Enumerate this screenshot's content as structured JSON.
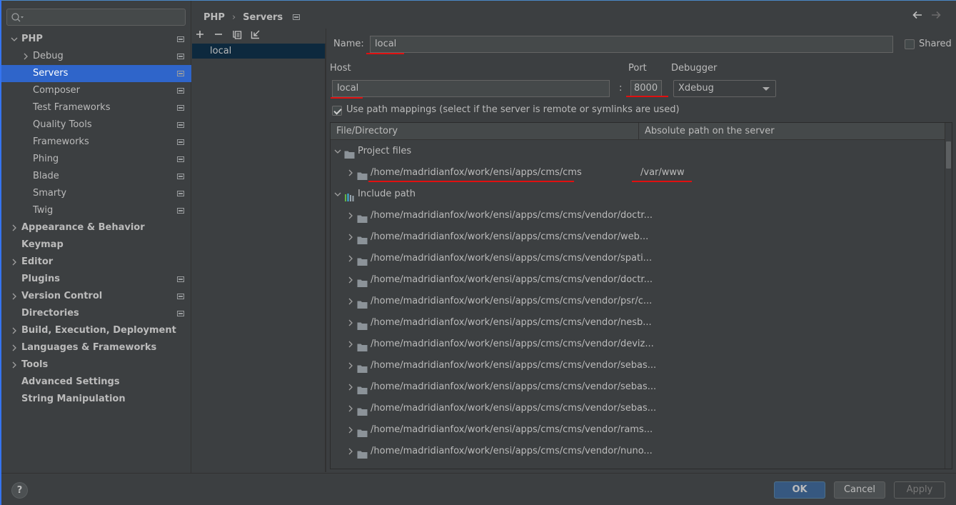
{
  "sidebar": {
    "search": {
      "placeholder": "",
      "value": ""
    },
    "items": [
      {
        "label": "PHP",
        "bold": true,
        "indent": 0,
        "chevron": "expanded",
        "project_icon": true
      },
      {
        "label": "Debug",
        "bold": false,
        "indent": 1,
        "chevron": "collapsed",
        "project_icon": true
      },
      {
        "label": "Servers",
        "bold": false,
        "indent": 1,
        "chevron": "none",
        "project_icon": true,
        "selected": true
      },
      {
        "label": "Composer",
        "bold": false,
        "indent": 1,
        "chevron": "none",
        "project_icon": true
      },
      {
        "label": "Test Frameworks",
        "bold": false,
        "indent": 1,
        "chevron": "none",
        "project_icon": true
      },
      {
        "label": "Quality Tools",
        "bold": false,
        "indent": 1,
        "chevron": "none",
        "project_icon": true
      },
      {
        "label": "Frameworks",
        "bold": false,
        "indent": 1,
        "chevron": "none",
        "project_icon": true
      },
      {
        "label": "Phing",
        "bold": false,
        "indent": 1,
        "chevron": "none",
        "project_icon": true
      },
      {
        "label": "Blade",
        "bold": false,
        "indent": 1,
        "chevron": "none",
        "project_icon": true
      },
      {
        "label": "Smarty",
        "bold": false,
        "indent": 1,
        "chevron": "none",
        "project_icon": true
      },
      {
        "label": "Twig",
        "bold": false,
        "indent": 1,
        "chevron": "none",
        "project_icon": true
      },
      {
        "label": "Appearance & Behavior",
        "bold": true,
        "indent": 0,
        "chevron": "collapsed",
        "project_icon": false
      },
      {
        "label": "Keymap",
        "bold": true,
        "indent": 0,
        "chevron": "none",
        "project_icon": false
      },
      {
        "label": "Editor",
        "bold": true,
        "indent": 0,
        "chevron": "collapsed",
        "project_icon": false
      },
      {
        "label": "Plugins",
        "bold": true,
        "indent": 0,
        "chevron": "none",
        "project_icon": true
      },
      {
        "label": "Version Control",
        "bold": true,
        "indent": 0,
        "chevron": "collapsed",
        "project_icon": true
      },
      {
        "label": "Directories",
        "bold": true,
        "indent": 0,
        "chevron": "none",
        "project_icon": true
      },
      {
        "label": "Build, Execution, Deployment",
        "bold": true,
        "indent": 0,
        "chevron": "collapsed",
        "project_icon": false
      },
      {
        "label": "Languages & Frameworks",
        "bold": true,
        "indent": 0,
        "chevron": "collapsed",
        "project_icon": false
      },
      {
        "label": "Tools",
        "bold": true,
        "indent": 0,
        "chevron": "collapsed",
        "project_icon": false
      },
      {
        "label": "Advanced Settings",
        "bold": true,
        "indent": 0,
        "chevron": "none",
        "project_icon": false
      },
      {
        "label": "String Manipulation",
        "bold": true,
        "indent": 0,
        "chevron": "none",
        "project_icon": false
      }
    ]
  },
  "header": {
    "breadcrumb": [
      "PHP",
      "Servers"
    ],
    "back_icon": "arrow-left-icon",
    "forward_icon": "arrow-right-icon"
  },
  "servers": {
    "toolbar": [
      "add-icon",
      "remove-icon",
      "copy-icon",
      "import-icon"
    ],
    "items": [
      {
        "label": "local",
        "selected": true
      }
    ]
  },
  "form": {
    "name_label": "Name:",
    "name_value": "local",
    "shared_label": "Shared",
    "shared_checked": false,
    "host_label": "Host",
    "host_value": "local",
    "port_label": "Port",
    "port_separator": ":",
    "port_value": "8000",
    "debugger_label": "Debugger",
    "debugger_value": "Xdebug",
    "path_mappings_label": "Use path mappings (select if the server is remote or symlinks are used)",
    "path_mappings_checked": true
  },
  "mappings_table": {
    "columns": [
      "File/Directory",
      "Absolute path on the server"
    ],
    "rows": [
      {
        "type": "group",
        "label": "Project files",
        "icon": "folder-icon",
        "expanded": true,
        "level": 0
      },
      {
        "type": "path",
        "label": "/home/madridianfox/work/ensi/apps/cms/cms",
        "server_path": "/var/www",
        "level": 1,
        "highlight": true
      },
      {
        "type": "group",
        "label": "Include path",
        "icon": "library-icon",
        "expanded": true,
        "level": 0
      },
      {
        "type": "path",
        "label": "/home/madridianfox/work/ensi/apps/cms/cms/vendor/doctr...",
        "server_path": "",
        "level": 1
      },
      {
        "type": "path",
        "label": "/home/madridianfox/work/ensi/apps/cms/cms/vendor/web...",
        "server_path": "",
        "level": 1
      },
      {
        "type": "path",
        "label": "/home/madridianfox/work/ensi/apps/cms/cms/vendor/spati...",
        "server_path": "",
        "level": 1
      },
      {
        "type": "path",
        "label": "/home/madridianfox/work/ensi/apps/cms/cms/vendor/doctr...",
        "server_path": "",
        "level": 1
      },
      {
        "type": "path",
        "label": "/home/madridianfox/work/ensi/apps/cms/cms/vendor/psr/c...",
        "server_path": "",
        "level": 1
      },
      {
        "type": "path",
        "label": "/home/madridianfox/work/ensi/apps/cms/cms/vendor/nesb...",
        "server_path": "",
        "level": 1
      },
      {
        "type": "path",
        "label": "/home/madridianfox/work/ensi/apps/cms/cms/vendor/deviz...",
        "server_path": "",
        "level": 1
      },
      {
        "type": "path",
        "label": "/home/madridianfox/work/ensi/apps/cms/cms/vendor/sebas...",
        "server_path": "",
        "level": 1
      },
      {
        "type": "path",
        "label": "/home/madridianfox/work/ensi/apps/cms/cms/vendor/sebas...",
        "server_path": "",
        "level": 1
      },
      {
        "type": "path",
        "label": "/home/madridianfox/work/ensi/apps/cms/cms/vendor/sebas...",
        "server_path": "",
        "level": 1
      },
      {
        "type": "path",
        "label": "/home/madridianfox/work/ensi/apps/cms/cms/vendor/rams...",
        "server_path": "",
        "level": 1
      },
      {
        "type": "path",
        "label": "/home/madridianfox/work/ensi/apps/cms/cms/vendor/nuno...",
        "server_path": "",
        "level": 1
      }
    ]
  },
  "footer": {
    "help_label": "?",
    "ok_label": "OK",
    "cancel_label": "Cancel",
    "apply_label": "Apply",
    "apply_enabled": false
  },
  "colors": {
    "selection": "#2f65ca",
    "annotation_underline": "#e01010",
    "ok_button": "#365880"
  }
}
